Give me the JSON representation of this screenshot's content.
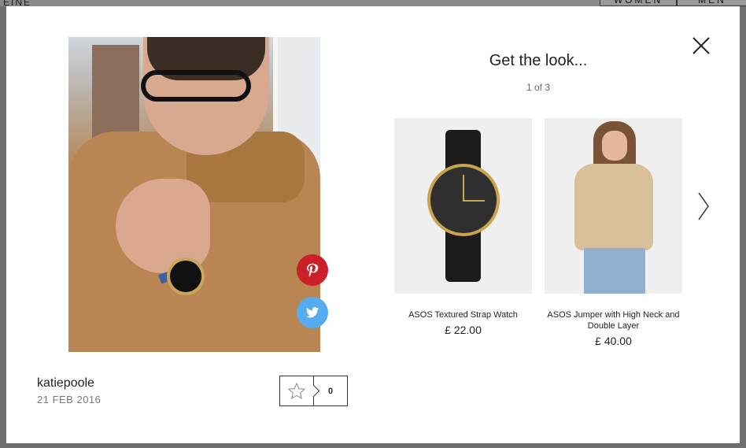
{
  "background_nav": {
    "left_link": "EINE",
    "women_label": "WOMEN",
    "men_label": "MEN"
  },
  "post": {
    "author": "katiepoole",
    "date": "21 FEB 2016",
    "like_count": "0"
  },
  "get_the_look": {
    "title": "Get the look...",
    "pagination": "1 of 3",
    "products": [
      {
        "name": "ASOS Textured Strap Watch",
        "price": "£ 22.00"
      },
      {
        "name": "ASOS Jumper with High Neck and Double Layer",
        "price": "£ 40.00"
      }
    ]
  },
  "colors": {
    "pinterest": "#cb2027",
    "twitter": "#55acee"
  },
  "icons": [
    "close-icon",
    "pinterest-icon",
    "twitter-icon",
    "star-icon",
    "chevron-right-icon"
  ]
}
